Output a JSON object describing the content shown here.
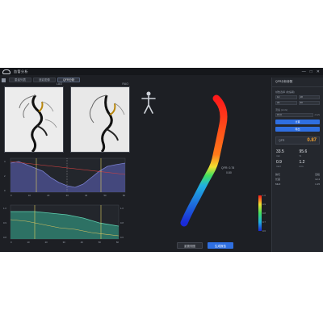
{
  "window": {
    "title": "血管分析",
    "controls": [
      "—",
      "□",
      "✕"
    ]
  },
  "tabs": [
    {
      "label": "患者列表"
    },
    {
      "label": "造影图像"
    },
    {
      "label": "QFR分析"
    }
  ],
  "angio": {
    "left_tag": "LAO",
    "right_tag": "RAO"
  },
  "plots": {
    "top": {
      "y_ticks": [
        "4",
        "2",
        "0"
      ],
      "x_ticks": [
        "0",
        "10",
        "20",
        "30",
        "40",
        "50",
        "60"
      ]
    },
    "bottom": {
      "y_ticks": [
        "1.0",
        "0.9",
        "0.8"
      ],
      "y2_ticks": [
        "1.0",
        "0.8",
        "0.6"
      ],
      "x_ticks": [
        "0",
        "10",
        "20",
        "30",
        "40",
        "50",
        "60"
      ]
    }
  },
  "vessel": {
    "annotation_line1": "QFR: 0.78",
    "annotation_line2": "0.80",
    "scale_ticks": [
      "1.0",
      "0.9",
      "0.8",
      "0.7",
      "0.6"
    ]
  },
  "bottom_buttons": {
    "reset_label": "重置视图",
    "report_label": "生成报告"
  },
  "right_panel": {
    "title": "QFR分析参数",
    "section1_label": "帧数选择 (收缩期)",
    "field_a": "12",
    "field_b": "18",
    "field_c": "24",
    "field_d": "30",
    "section2_label": "流速 (cm/s)",
    "flow_value": "15.0",
    "flow_unit": "cm/s",
    "btn_compute": "计算",
    "btn_export": "导出",
    "metric_key": "QFR",
    "metric_value": "0.87",
    "stats": [
      {
        "value": "33.5",
        "unit": "mm"
      },
      {
        "value": "95.6",
        "unit": "%"
      },
      {
        "value": "0.9",
        "unit": "mm²"
      },
      {
        "value": "1.2",
        "unit": "mm"
      }
    ],
    "table": [
      {
        "k": "狭窄",
        "v": "近段"
      },
      {
        "k": "长度",
        "v": "12.4"
      },
      {
        "k": "MLD",
        "v": "1.15"
      }
    ]
  }
}
